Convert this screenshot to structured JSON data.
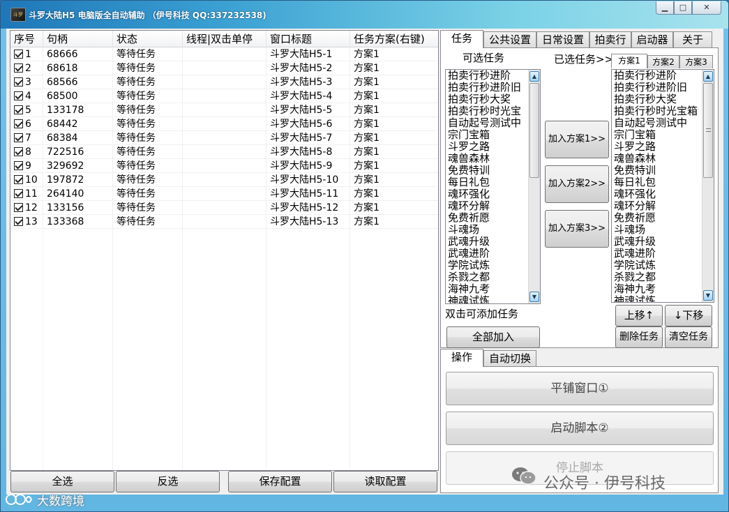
{
  "window": {
    "title": "斗罗大陆H5 电脑版全自动辅助 （伊号科技 QQ:337232538)",
    "icon_text": "斗罗",
    "controls": {
      "minimize": "▁",
      "maximize": "□",
      "close": "✕"
    }
  },
  "list": {
    "columns": [
      "序号",
      "句柄",
      "状态",
      "线程|双击单停",
      "窗口标题",
      "任务方案(右键)"
    ],
    "rows": [
      {
        "index": "1",
        "handle": "68666",
        "status": "等待任务",
        "thread": "",
        "title": "斗罗大陆H5-1",
        "plan": "方案1"
      },
      {
        "index": "2",
        "handle": "68618",
        "status": "等待任务",
        "thread": "",
        "title": "斗罗大陆H5-2",
        "plan": "方案1"
      },
      {
        "index": "3",
        "handle": "68566",
        "status": "等待任务",
        "thread": "",
        "title": "斗罗大陆H5-3",
        "plan": "方案1"
      },
      {
        "index": "4",
        "handle": "68500",
        "status": "等待任务",
        "thread": "",
        "title": "斗罗大陆H5-4",
        "plan": "方案1"
      },
      {
        "index": "5",
        "handle": "133178",
        "status": "等待任务",
        "thread": "",
        "title": "斗罗大陆H5-5",
        "plan": "方案1"
      },
      {
        "index": "6",
        "handle": "68442",
        "status": "等待任务",
        "thread": "",
        "title": "斗罗大陆H5-6",
        "plan": "方案1"
      },
      {
        "index": "7",
        "handle": "68384",
        "status": "等待任务",
        "thread": "",
        "title": "斗罗大陆H5-7",
        "plan": "方案1"
      },
      {
        "index": "8",
        "handle": "722516",
        "status": "等待任务",
        "thread": "",
        "title": "斗罗大陆H5-8",
        "plan": "方案1"
      },
      {
        "index": "9",
        "handle": "329692",
        "status": "等待任务",
        "thread": "",
        "title": "斗罗大陆H5-9",
        "plan": "方案1"
      },
      {
        "index": "10",
        "handle": "197872",
        "status": "等待任务",
        "thread": "",
        "title": "斗罗大陆H5-10",
        "plan": "方案1"
      },
      {
        "index": "11",
        "handle": "264140",
        "status": "等待任务",
        "thread": "",
        "title": "斗罗大陆H5-11",
        "plan": "方案1"
      },
      {
        "index": "12",
        "handle": "133156",
        "status": "等待任务",
        "thread": "",
        "title": "斗罗大陆H5-12",
        "plan": "方案1"
      },
      {
        "index": "13",
        "handle": "133368",
        "status": "等待任务",
        "thread": "",
        "title": "斗罗大陆H5-13",
        "plan": "方案1"
      }
    ]
  },
  "bottom_buttons": {
    "select_all": "全选",
    "invert": "反选",
    "save_config": "保存配置",
    "load_config": "读取配置"
  },
  "main_tabs": [
    "任务",
    "公共设置",
    "日常设置",
    "拍卖行",
    "启动器",
    "关于"
  ],
  "task_panel": {
    "available_label": "可选任务",
    "selected_label": "已选任务>>",
    "plan_tabs": [
      "方案1",
      "方案2",
      "方案3"
    ],
    "available_tasks": [
      "拍卖行秒进阶",
      "拍卖行秒进阶旧",
      "拍卖行秒大奖",
      "拍卖行秒时光宝",
      "自动起号测试中",
      "宗门宝箱",
      "斗罗之路",
      "魂兽森林",
      "免费特训",
      "每日礼包",
      "魂环强化",
      "魂环分解",
      "免费祈愿",
      "斗魂场",
      "武魂升级",
      "武魂进阶",
      "学院试炼",
      "杀戮之都",
      "海神九考",
      "神魂试炼"
    ],
    "selected_tasks": [
      "拍卖行秒进阶",
      "拍卖行秒进阶旧",
      "拍卖行秒大奖",
      "拍卖行秒时光宝箱",
      "自动起号测试中",
      "宗门宝箱",
      "斗罗之路",
      "魂兽森林",
      "免费特训",
      "每日礼包",
      "魂环强化",
      "魂环分解",
      "免费祈愿",
      "斗魂场",
      "武魂升级",
      "武魂进阶",
      "学院试炼",
      "杀戮之都",
      "海神九考",
      "神魂试炼"
    ],
    "add_plan1": "加入方案1>>",
    "add_plan2": "加入方案2>>",
    "add_plan3": "加入方案3>>",
    "hint": "双击可添加任务",
    "add_all": "全部加入",
    "move_up": "上移↑",
    "move_down": "↓下移",
    "delete_task": "删除任务",
    "clear_tasks": "清空任务"
  },
  "op_tabs": [
    "操作",
    "自动切换"
  ],
  "operations": {
    "tile_windows": "平铺窗口①",
    "start_script": "启动脚本②",
    "stop_script": "停止脚本"
  },
  "watermarks": {
    "wechat": "公众号 · 伊号科技",
    "corner": "大数跨境"
  }
}
